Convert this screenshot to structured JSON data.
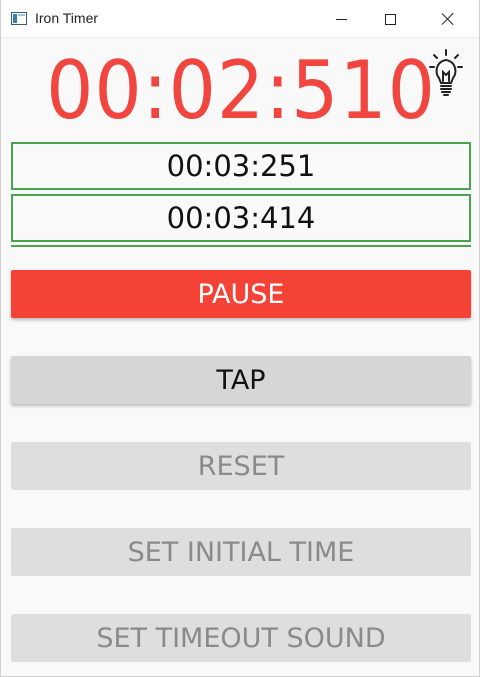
{
  "window": {
    "title": "Iron Timer"
  },
  "timer": {
    "main_time": "00:02:510",
    "laps": [
      "00:03:251",
      "00:03:414"
    ]
  },
  "buttons": {
    "pause": "PAUSE",
    "tap": "TAP",
    "reset": "RESET",
    "set_initial_time": "SET INITIAL TIME",
    "set_timeout_sound": "SET TIMEOUT SOUND"
  },
  "icons": {
    "app": "app-window-icon",
    "hint": "lightbulb-icon"
  },
  "colors": {
    "timer": "#f0463f",
    "pause_button": "#f44336",
    "lap_border": "#4aa34d",
    "disabled_text": "#8a8a8a"
  }
}
